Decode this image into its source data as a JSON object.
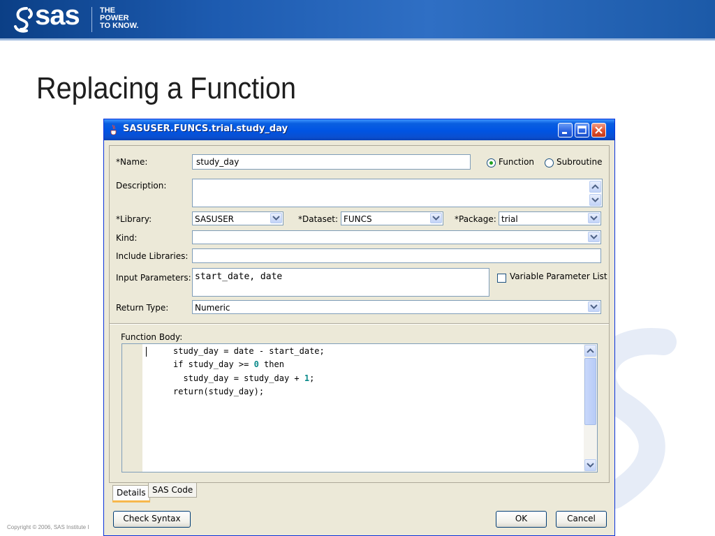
{
  "slide": {
    "brand": "sas",
    "tagline": [
      "THE",
      "POWER",
      "TO KNOW."
    ],
    "title": "Replacing a Function",
    "copyright": "Copyright © 2006, SAS Institute I"
  },
  "window": {
    "title": "SASUSER.FUNCS.trial.study_day",
    "buttons": [
      "minimize-icon",
      "maximize-icon",
      "close-icon"
    ]
  },
  "form": {
    "name_label": "*Name:",
    "name_value": "study_day",
    "type_options": [
      "Function",
      "Subroutine"
    ],
    "type_selected": "Function",
    "description_label": "Description:",
    "description_value": "",
    "library_label": "*Library:",
    "library_value": "SASUSER",
    "dataset_label": "*Dataset:",
    "dataset_value": "FUNCS",
    "package_label": "*Package:",
    "package_value": "trial",
    "kind_label": "Kind:",
    "kind_value": "",
    "include_label": "Include Libraries:",
    "include_value": "",
    "params_label": "Input Parameters:",
    "params_value": "start_date, date",
    "varparam_label": "Variable Parameter List",
    "varparam_checked": false,
    "return_label": "Return Type:",
    "return_value": "Numeric"
  },
  "body": {
    "label": "Function Body:",
    "lines": [
      [
        {
          "t": "study_day = date - start_date;"
        }
      ],
      [
        {
          "t": "if study_day >= "
        },
        {
          "t": "0",
          "num": true
        },
        {
          "t": " then"
        }
      ],
      [
        {
          "t": "  study_day = study_day + "
        },
        {
          "t": "1",
          "num": true
        },
        {
          "t": ";"
        }
      ],
      [
        {
          "t": "return(study_day);"
        }
      ]
    ]
  },
  "tabs": [
    "Details",
    "SAS Code"
  ],
  "active_tab": "Details",
  "footer": {
    "check_syntax": "Check Syntax",
    "ok": "OK",
    "cancel": "Cancel"
  },
  "colors": {
    "titlebar": "#0054e3",
    "window_bg": "#ece9d8",
    "number_literal": "#0a8a8a"
  }
}
